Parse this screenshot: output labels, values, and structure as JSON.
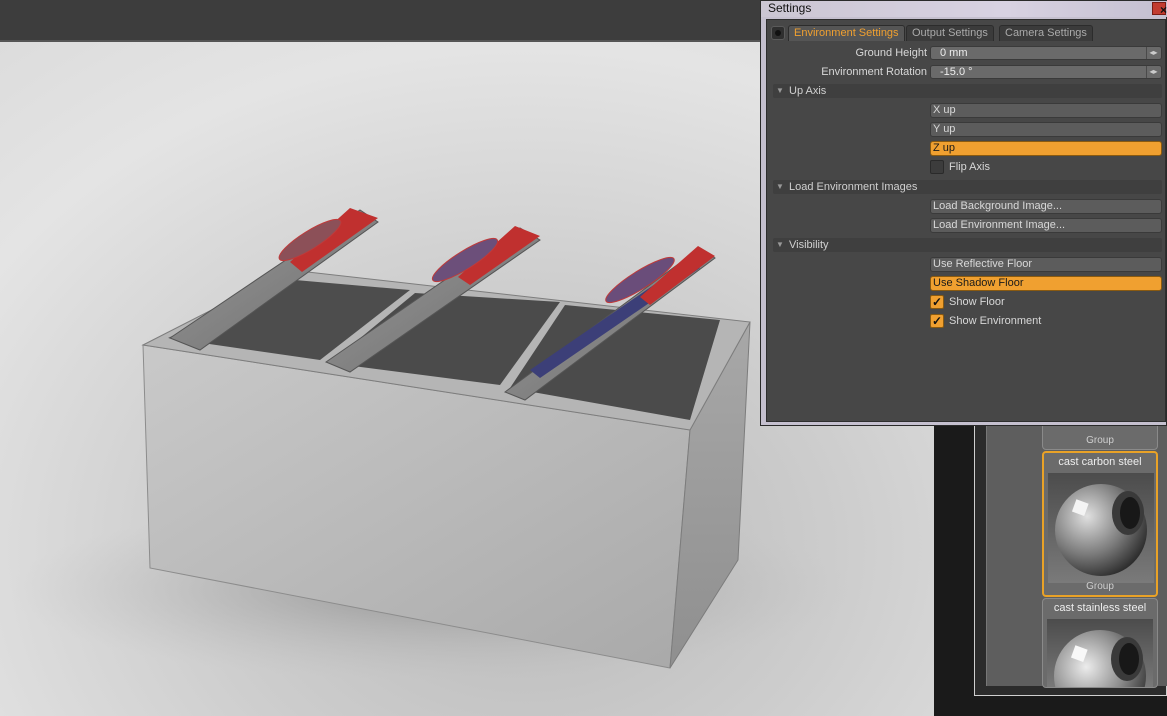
{
  "settings": {
    "window_title": "Settings",
    "tabs": [
      {
        "label": "Environment Settings",
        "active": true
      },
      {
        "label": "Output Settings",
        "active": false
      },
      {
        "label": "Camera Settings",
        "active": false
      }
    ],
    "ground_height": {
      "label": "Ground Height",
      "value": "0 mm"
    },
    "env_rotation": {
      "label": "Environment Rotation",
      "value": "-15.0 °"
    },
    "sections": {
      "up_axis": {
        "title": "Up Axis",
        "x_up": "X up",
        "y_up": "Y up",
        "z_up": "Z up",
        "selected": "Z up",
        "flip_axis": {
          "label": "Flip Axis",
          "checked": false
        }
      },
      "load_env": {
        "title": "Load Environment Images",
        "load_background": "Load Background Image...",
        "load_environment": "Load Environment Image..."
      },
      "visibility": {
        "title": "Visibility",
        "reflective_floor": {
          "label": "Use Reflective Floor",
          "active": false
        },
        "shadow_floor": {
          "label": "Use Shadow Floor",
          "active": true
        },
        "show_floor": {
          "label": "Show Floor",
          "checked": true
        },
        "show_environment": {
          "label": "Show Environment",
          "checked": true
        }
      }
    }
  },
  "materials": {
    "items": [
      {
        "title": "",
        "subtitle": "Group"
      },
      {
        "title": "cast carbon steel",
        "subtitle": "Group",
        "selected": true
      },
      {
        "title": "cast stainless steel",
        "subtitle": ""
      }
    ]
  },
  "colors": {
    "accent": "#f0a030",
    "panel_bg": "#474747",
    "section_bg": "#3f3f3f"
  }
}
